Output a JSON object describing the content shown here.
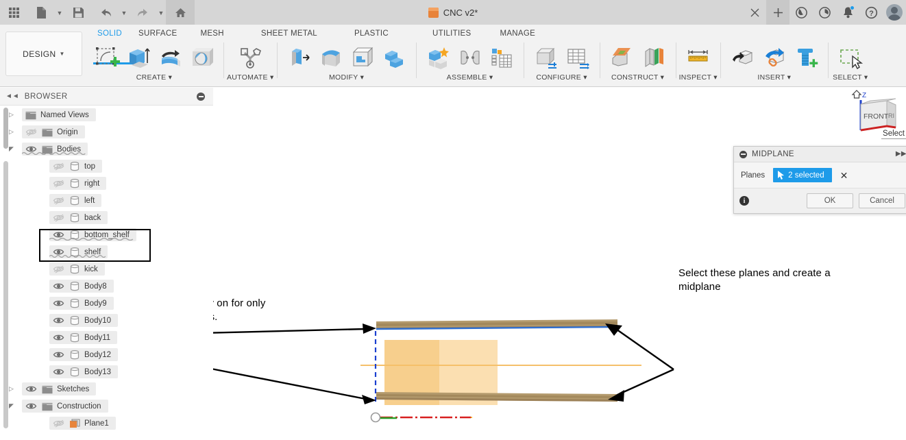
{
  "titlebar": {
    "document_name": "CNC v2*",
    "quick_access": [
      {
        "name": "app-grid-icon",
        "label": "Show Data Panel"
      },
      {
        "name": "file-icon",
        "label": "File"
      },
      {
        "name": "save-icon",
        "label": "Save"
      },
      {
        "name": "undo-icon",
        "label": "Undo"
      },
      {
        "name": "redo-icon",
        "label": "Redo"
      },
      {
        "name": "home-icon",
        "label": "Home"
      }
    ],
    "right_icons": [
      {
        "name": "close-tab-icon",
        "label": "×"
      },
      {
        "name": "new-tab-icon",
        "label": "+"
      },
      {
        "name": "refresh-icon",
        "label": "Refresh"
      },
      {
        "name": "job-status-icon",
        "label": "Job Status"
      },
      {
        "name": "notifications-icon",
        "label": "Notifications"
      },
      {
        "name": "help-icon",
        "label": "Help"
      },
      {
        "name": "account-avatar",
        "label": "Account"
      }
    ]
  },
  "ribbon": {
    "workspace": "DESIGN",
    "tabs": [
      {
        "label": "SOLID",
        "active": true
      },
      {
        "label": "SURFACE",
        "active": false
      },
      {
        "label": "MESH",
        "active": false
      },
      {
        "label": "SHEET METAL",
        "active": false
      },
      {
        "label": "PLASTIC",
        "active": false
      },
      {
        "label": "UTILITIES",
        "active": false
      },
      {
        "label": "MANAGE",
        "active": false
      }
    ],
    "groups": [
      {
        "label": "CREATE ▾",
        "icons": [
          "create-sketch-icon",
          "extrude-icon",
          "revolve-icon",
          "sphere-icon"
        ]
      },
      {
        "label": "AUTOMATE ▾",
        "icons": [
          "automate-icon"
        ]
      },
      {
        "label": "MODIFY ▾",
        "icons": [
          "press-pull-icon",
          "fillet-icon",
          "shell-icon",
          "combine-icon"
        ]
      },
      {
        "label": "ASSEMBLE ▾",
        "icons": [
          "new-component-icon",
          "joint-icon",
          "contact-set-icon"
        ]
      },
      {
        "label": "CONFIGURE ▾",
        "icons": [
          "configure-icon",
          "configuration-table-icon"
        ]
      },
      {
        "label": "CONSTRUCT ▾",
        "icons": [
          "offset-plane-icon",
          "midplane-icon"
        ]
      },
      {
        "label": "INSPECT ▾",
        "icons": [
          "measure-icon"
        ]
      },
      {
        "label": "INSERT ▾",
        "icons": [
          "insert-derive-icon",
          "insert-mcmaster-icon",
          "insert-fastener-icon"
        ]
      },
      {
        "label": "SELECT ▾",
        "icons": [
          "window-select-icon"
        ]
      }
    ],
    "accent_color": "#1e9be9"
  },
  "browser": {
    "title": "BROWSER",
    "collapse_icon": "collapse-panel-icon",
    "minimize_icon": "minimize-icon",
    "items": [
      {
        "label": "Named Views",
        "type": "folder",
        "indent": 1,
        "disclosure": "collapsed",
        "eye": "none",
        "highlight": false
      },
      {
        "label": "Origin",
        "type": "folder",
        "indent": 1,
        "disclosure": "collapsed",
        "eye": "hidden",
        "highlight": false
      },
      {
        "label": "Bodies",
        "type": "folder",
        "indent": 1,
        "disclosure": "expanded",
        "eye": "visible",
        "highlight": true
      },
      {
        "label": "top",
        "type": "body",
        "indent": 2,
        "disclosure": "none",
        "eye": "hidden",
        "highlight": false
      },
      {
        "label": "right",
        "type": "body",
        "indent": 2,
        "disclosure": "none",
        "eye": "hidden",
        "highlight": false
      },
      {
        "label": "left",
        "type": "body",
        "indent": 2,
        "disclosure": "none",
        "eye": "hidden",
        "highlight": false
      },
      {
        "label": "back",
        "type": "body",
        "indent": 2,
        "disclosure": "none",
        "eye": "hidden",
        "highlight": false
      },
      {
        "label": "bottom_shelf",
        "type": "body",
        "indent": 2,
        "disclosure": "none",
        "eye": "visible",
        "highlight": true
      },
      {
        "label": "shelf",
        "type": "body",
        "indent": 2,
        "disclosure": "none",
        "eye": "visible",
        "highlight": true
      },
      {
        "label": "kick",
        "type": "body",
        "indent": 2,
        "disclosure": "none",
        "eye": "hidden",
        "highlight": false
      },
      {
        "label": "Body8",
        "type": "body",
        "indent": 2,
        "disclosure": "none",
        "eye": "visible",
        "highlight": false
      },
      {
        "label": "Body9",
        "type": "body",
        "indent": 2,
        "disclosure": "none",
        "eye": "visible",
        "highlight": false
      },
      {
        "label": "Body10",
        "type": "body",
        "indent": 2,
        "disclosure": "none",
        "eye": "visible",
        "highlight": false
      },
      {
        "label": "Body11",
        "type": "body",
        "indent": 2,
        "disclosure": "none",
        "eye": "visible",
        "highlight": false
      },
      {
        "label": "Body12",
        "type": "body",
        "indent": 2,
        "disclosure": "none",
        "eye": "visible",
        "highlight": false
      },
      {
        "label": "Body13",
        "type": "body",
        "indent": 2,
        "disclosure": "none",
        "eye": "visible",
        "highlight": false
      },
      {
        "label": "Sketches",
        "type": "folder",
        "indent": 1,
        "disclosure": "collapsed",
        "eye": "visible",
        "highlight": false
      },
      {
        "label": "Construction",
        "type": "folder",
        "indent": 1,
        "disclosure": "expanded",
        "eye": "visible",
        "highlight": false
      },
      {
        "label": "Plane1",
        "type": "plane",
        "indent": 2,
        "disclosure": "none",
        "eye": "hidden",
        "highlight": false
      }
    ]
  },
  "dialog": {
    "title": "MIDPLANE",
    "field_label": "Planes",
    "selection_value": "2 selected",
    "selection_icon": "cursor-arrow-icon",
    "clear_icon": "clear-selection-icon",
    "info_icon": "info-icon",
    "ok_label": "OK",
    "cancel_label": "Cancel",
    "accent_color": "#1e9be9"
  },
  "viewcube": {
    "front_face": "FRONT",
    "right_face": "RIGHT",
    "home_icon": "home-view-icon",
    "z_axis_label": "Z",
    "tooltip": "Select"
  },
  "annotations": [
    {
      "name": "visibility-annotation",
      "text_line1": "Turn the visibility on for only",
      "text_line2": "these two bodies."
    },
    {
      "name": "midplane-annotation",
      "text_line1": "Select these planes and create a",
      "text_line2": "midplane"
    }
  ],
  "canvas": {
    "shelf_color": "#a8936a",
    "midplane_preview_color": "#f5b942",
    "highlight_edge_color": "#2f6fd0",
    "origin_icon": "origin-point-icon"
  }
}
